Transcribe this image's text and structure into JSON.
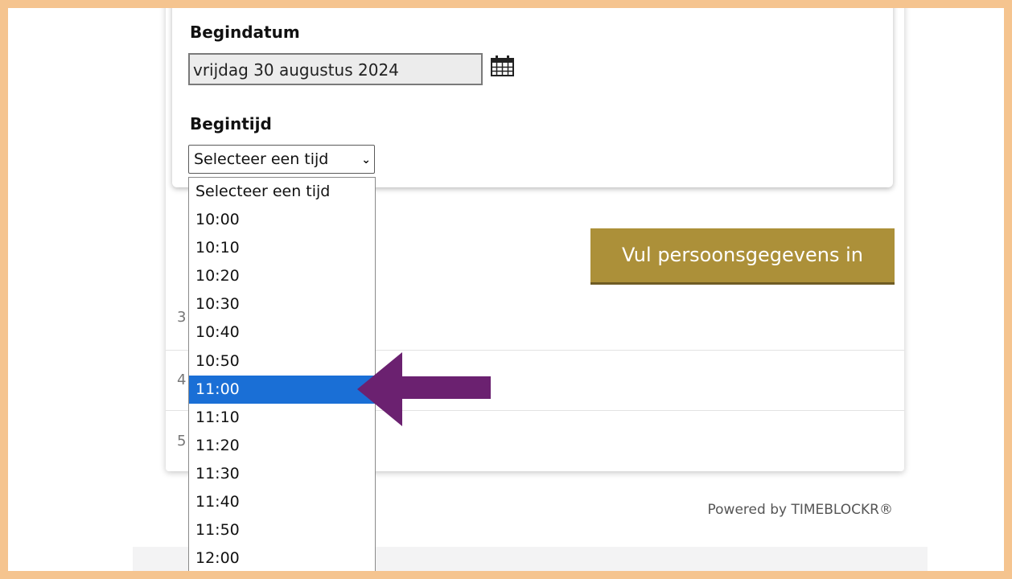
{
  "form": {
    "start_date_label": "Begindatum",
    "start_date_value": "vrijdag 30 augustus 2024",
    "start_time_label": "Begintijd",
    "start_time_selected": "Selecteer een tijd"
  },
  "time_options": [
    "Selecteer een tijd",
    "10:00",
    "10:10",
    "10:20",
    "10:30",
    "10:40",
    "10:50",
    "11:00",
    "11:10",
    "11:20",
    "11:30",
    "11:40",
    "11:50",
    "12:00"
  ],
  "highlighted_option": "11:00",
  "actions": {
    "fill_details_label": "Vul persoonsgegevens in"
  },
  "list_rows": [
    "3",
    "4",
    "5"
  ],
  "footer": {
    "powered_by": "Powered by TIMEBLOCKR®"
  },
  "colors": {
    "frame": "#f5c48f",
    "button": "#ac9039",
    "selection": "#1a6fd6",
    "arrow": "#6b2170"
  },
  "icons": {
    "calendar": "calendar-icon",
    "chevron": "chevron-down-icon",
    "annotation": "arrow-left-icon"
  }
}
